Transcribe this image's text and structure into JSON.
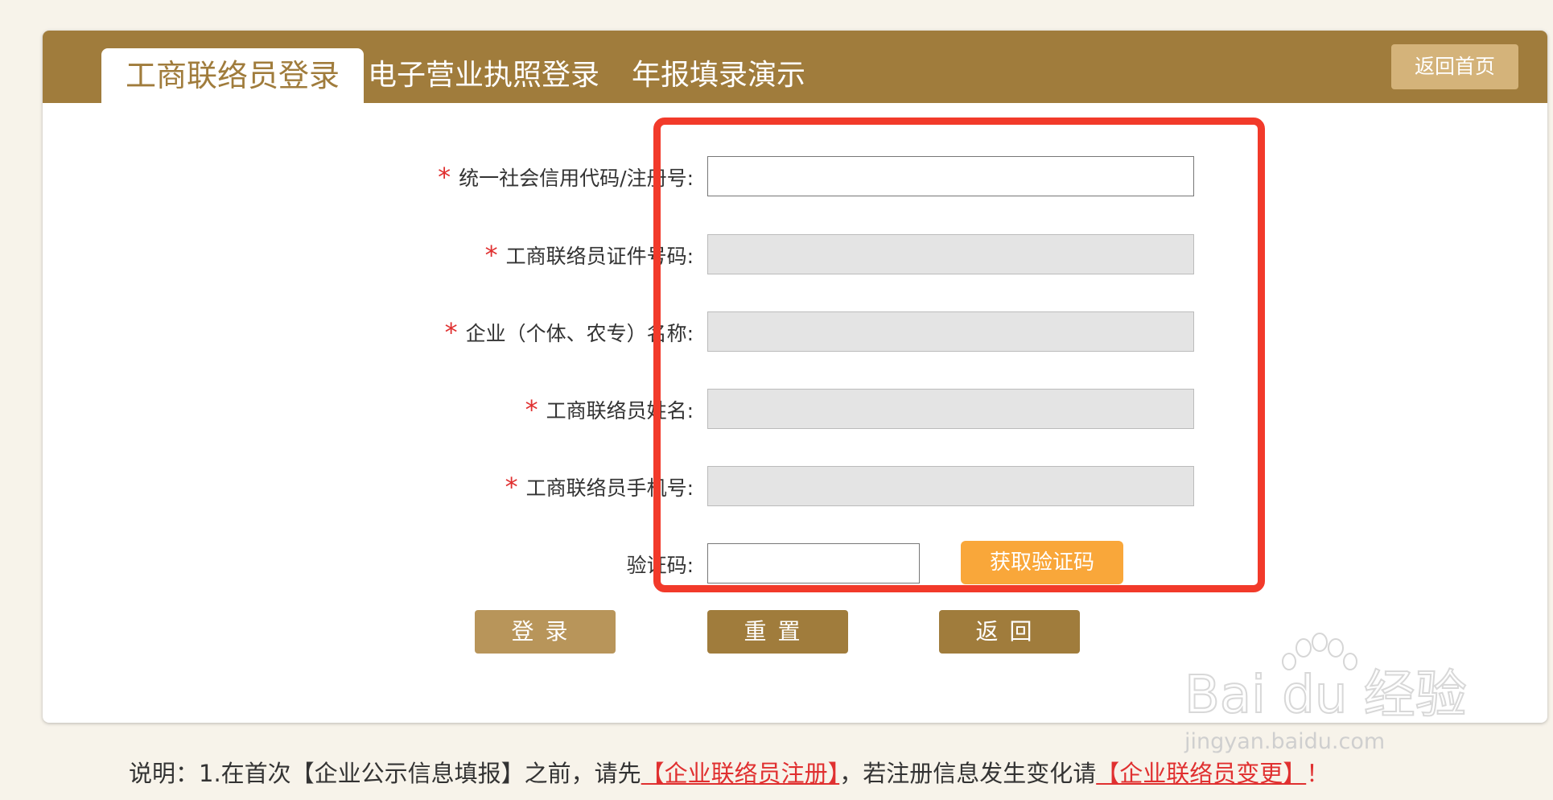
{
  "header": {
    "tabs": [
      "工商联络员登录",
      "电子营业执照登录",
      "年报填录演示"
    ],
    "home_label": "返回首页"
  },
  "form": {
    "required_mark": "*",
    "fields": [
      {
        "label": "统一社会信用代码/注册号:",
        "required": true,
        "value": "",
        "disabled": false
      },
      {
        "label": "工商联络员证件号码:",
        "required": true,
        "value": "",
        "disabled": true
      },
      {
        "label": "企业（个体、农专）名称:",
        "required": true,
        "value": "",
        "disabled": true
      },
      {
        "label": "工商联络员姓名:",
        "required": true,
        "value": "",
        "disabled": true
      },
      {
        "label": "工商联络员手机号:",
        "required": true,
        "value": "",
        "disabled": true
      }
    ],
    "captcha": {
      "label": "验证码:",
      "value": "",
      "button": "获取验证码"
    }
  },
  "actions": {
    "login": "登录",
    "reset": "重置",
    "back": "返回"
  },
  "note": {
    "prefix": "说明：1.在首次【企业公示信息填报】之前，请先",
    "link1": "【企业联络员注册】",
    "middle": "，若注册信息发生变化请",
    "link2": "【企业联络员变更】",
    "suffix": "！"
  },
  "watermark": {
    "logo": "Bai du 经验",
    "url": "jingyan.baidu.com"
  },
  "colors": {
    "brand": "#a07c3c",
    "accent_orange": "#f9a73a",
    "required_red": "#e03030",
    "highlight_red": "#f23a2a"
  }
}
